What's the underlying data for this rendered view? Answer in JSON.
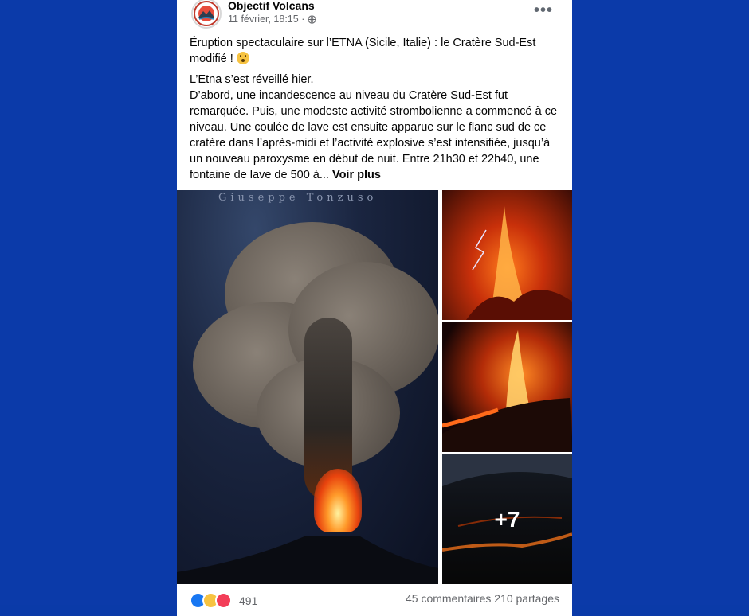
{
  "post": {
    "page_name": "Objectif Volcans",
    "date": "11 février, 18:15 ·",
    "title": "Éruption spectaculaire sur l’ETNA (Sicile, Italie) : le Cratère Sud-Est modifié !",
    "body_lines": [
      "L’Etna s’est réveillé hier.",
      "D’abord, une incandescence au niveau du Cratère Sud-Est fut remarquée. Puis, une modeste activité strombolienne a commencé à ce niveau. Une coulée de lave est ensuite apparue sur le flanc sud de ce cratère dans l’après-midi et l’activité explosive s’est intensifiée, jusqu’à un nouveau paroxysme en début de nuit. Entre 21h30 et 22h40, une fontaine de lave de 500 à..."
    ],
    "see_more": "Voir plus",
    "photo_credit": "Giuseppe Tonzuso",
    "more_photos": "+7",
    "reactions_count": "491",
    "comments": "45 commentaires",
    "shares": "210 partages",
    "icons": {
      "more": "more-horizontal-icon",
      "privacy": "globe-icon",
      "emoji": "astonished-face-emoji"
    }
  }
}
